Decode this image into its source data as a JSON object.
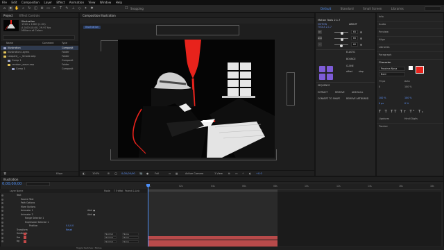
{
  "menu": [
    "File",
    "Edit",
    "Composition",
    "Layer",
    "Effect",
    "Animation",
    "View",
    "Window",
    "Help"
  ],
  "toolbar": {
    "snapping": "Snapping",
    "workspaces": [
      "Default",
      "Standard",
      "Small Screen",
      "Libraries"
    ],
    "active_workspace": "Default"
  },
  "project": {
    "tabs": [
      "Project",
      "Effect Controls"
    ],
    "item_name": "Illustration",
    "item_info": [
      "1920 x 1080 (1.00)",
      "Δ 0;00;10;00, 29.97 fps",
      "Millions of Colors"
    ],
    "columns": [
      "Name",
      "Comment",
      "Type"
    ],
    "rows": [
      {
        "name": "Illustration",
        "type": "Composit",
        "color": "#9aa3c6",
        "selected": true
      },
      {
        "name": "Illustration Layers",
        "type": "Folder",
        "color": "#e2c35a",
        "selected": false
      },
      {
        "name": "Leopard_..._Smoke.aep",
        "type": "Folder",
        "color": "#e2c35a",
        "selected": false
      },
      {
        "name": "Comp 1",
        "type": "Composit",
        "color": "#9aa3c6",
        "selected": false
      },
      {
        "name": "random_wave.aep",
        "type": "Folder",
        "color": "#e2c35a",
        "selected": false
      },
      {
        "name": "Comp 1",
        "type": "Composit",
        "color": "#9aa3c6",
        "selected": false
      }
    ],
    "footer": "8 bpc"
  },
  "composition": {
    "tab_title": "Composition Illustration",
    "comp_chip": "Illustration",
    "zoom": "100%",
    "timecode": "0;00;00;00",
    "resolution": "Full",
    "camera": "Active Camera",
    "views": "1 View",
    "exposure": "+0.0"
  },
  "motion_tools": {
    "title": "Motion Tools 2.1.7",
    "brand_line1": "MOTION",
    "brand_line2": "TOOLS 2.1.7",
    "about": "ABOUT",
    "sliders": [
      {
        "label": "in",
        "value": "65",
        "knob": 0.55
      },
      {
        "label": "out",
        "value": "65",
        "knob": 0.55
      },
      {
        "label": "~",
        "value": "60",
        "knob": 0.5
      }
    ],
    "labels": {
      "elastic": "ELASTIC",
      "bounce": "BOUNCE",
      "clone": "CLONE",
      "offset": "offset",
      "step": "step",
      "sequence": "SEQUENCE",
      "extract": "EXTRACT",
      "remove": "REMOVE",
      "add_null": "ADD NULL",
      "convert": "CONVERT TO SHAPE",
      "remove_artboard": "REMOVE ARTBOARD"
    }
  },
  "right_panel": {
    "items": [
      "Info",
      "Audio",
      "Preview",
      "Align",
      "Libraries",
      "Paragraph"
    ],
    "character": "Character",
    "font": "Proxima Nova",
    "style": "Bold",
    "size": "75 px",
    "leading": "Auto",
    "tracking": "100 %",
    "kerning": "0",
    "scale_v": "100 %",
    "scale_h": "100 %",
    "baseline": "0 px",
    "tsume": "0 %",
    "ligatures": "Ligatures",
    "hindi": "Hindi Digits",
    "tracker": "Tracker"
  },
  "timeline": {
    "tab": "Illustration",
    "timecode": "0;00;00;00",
    "columns": [
      "Layer Name",
      "Mode",
      "T TrkMat",
      "Parent & Link"
    ],
    "ruler": [
      "0s",
      "02s",
      "04s",
      "06s",
      "08s",
      "10s",
      "12s",
      "14s",
      "16s",
      "18s"
    ],
    "rows": [
      {
        "name": "Text",
        "indent": 16,
        "link": "",
        "add": "",
        "label": ""
      },
      {
        "name": "Source Text",
        "indent": 22,
        "link": "",
        "add": "",
        "label": ""
      },
      {
        "name": "Path Options",
        "indent": 22,
        "link": "",
        "add": "",
        "label": ""
      },
      {
        "name": "More Options",
        "indent": 22,
        "link": "",
        "add": "",
        "label": ""
      },
      {
        "name": "Animator 1",
        "indent": 22,
        "link": "",
        "add": "Add: ●",
        "label": ""
      },
      {
        "name": "Animator 2",
        "indent": 22,
        "link": "",
        "add": "Add: ●",
        "label": ""
      },
      {
        "name": "Range Selector 1",
        "indent": 28,
        "link": "",
        "add": "",
        "label": ""
      },
      {
        "name": "Expression Selector 1",
        "indent": 28,
        "link": "",
        "add": "",
        "label": ""
      },
      {
        "name": "Position",
        "indent": 34,
        "link": "0.0,0.0",
        "add": "",
        "label": ""
      },
      {
        "name": "Transform",
        "indent": 16,
        "link": "Reset",
        "add": "",
        "label": ""
      },
      {
        "name": "Scatter fx",
        "indent": 16,
        "link": "",
        "add": "",
        "mode": "Normal",
        "parent": "None",
        "label": "#c34949"
      },
      {
        "name": "fire",
        "indent": 16,
        "link": "",
        "add": "",
        "mode": "Normal",
        "parent": "None",
        "label": "#c34949"
      },
      {
        "name": "bg",
        "indent": 16,
        "link": "",
        "add": "",
        "mode": "Normal",
        "parent": "None",
        "label": "#c34949"
      }
    ],
    "footer": "Toggle Switches / Modes"
  },
  "colors": {
    "accent": "#4d8ff7",
    "purple": "#7e5cd8",
    "red": "#e8231c",
    "layer_bar": "#b84a4a"
  }
}
